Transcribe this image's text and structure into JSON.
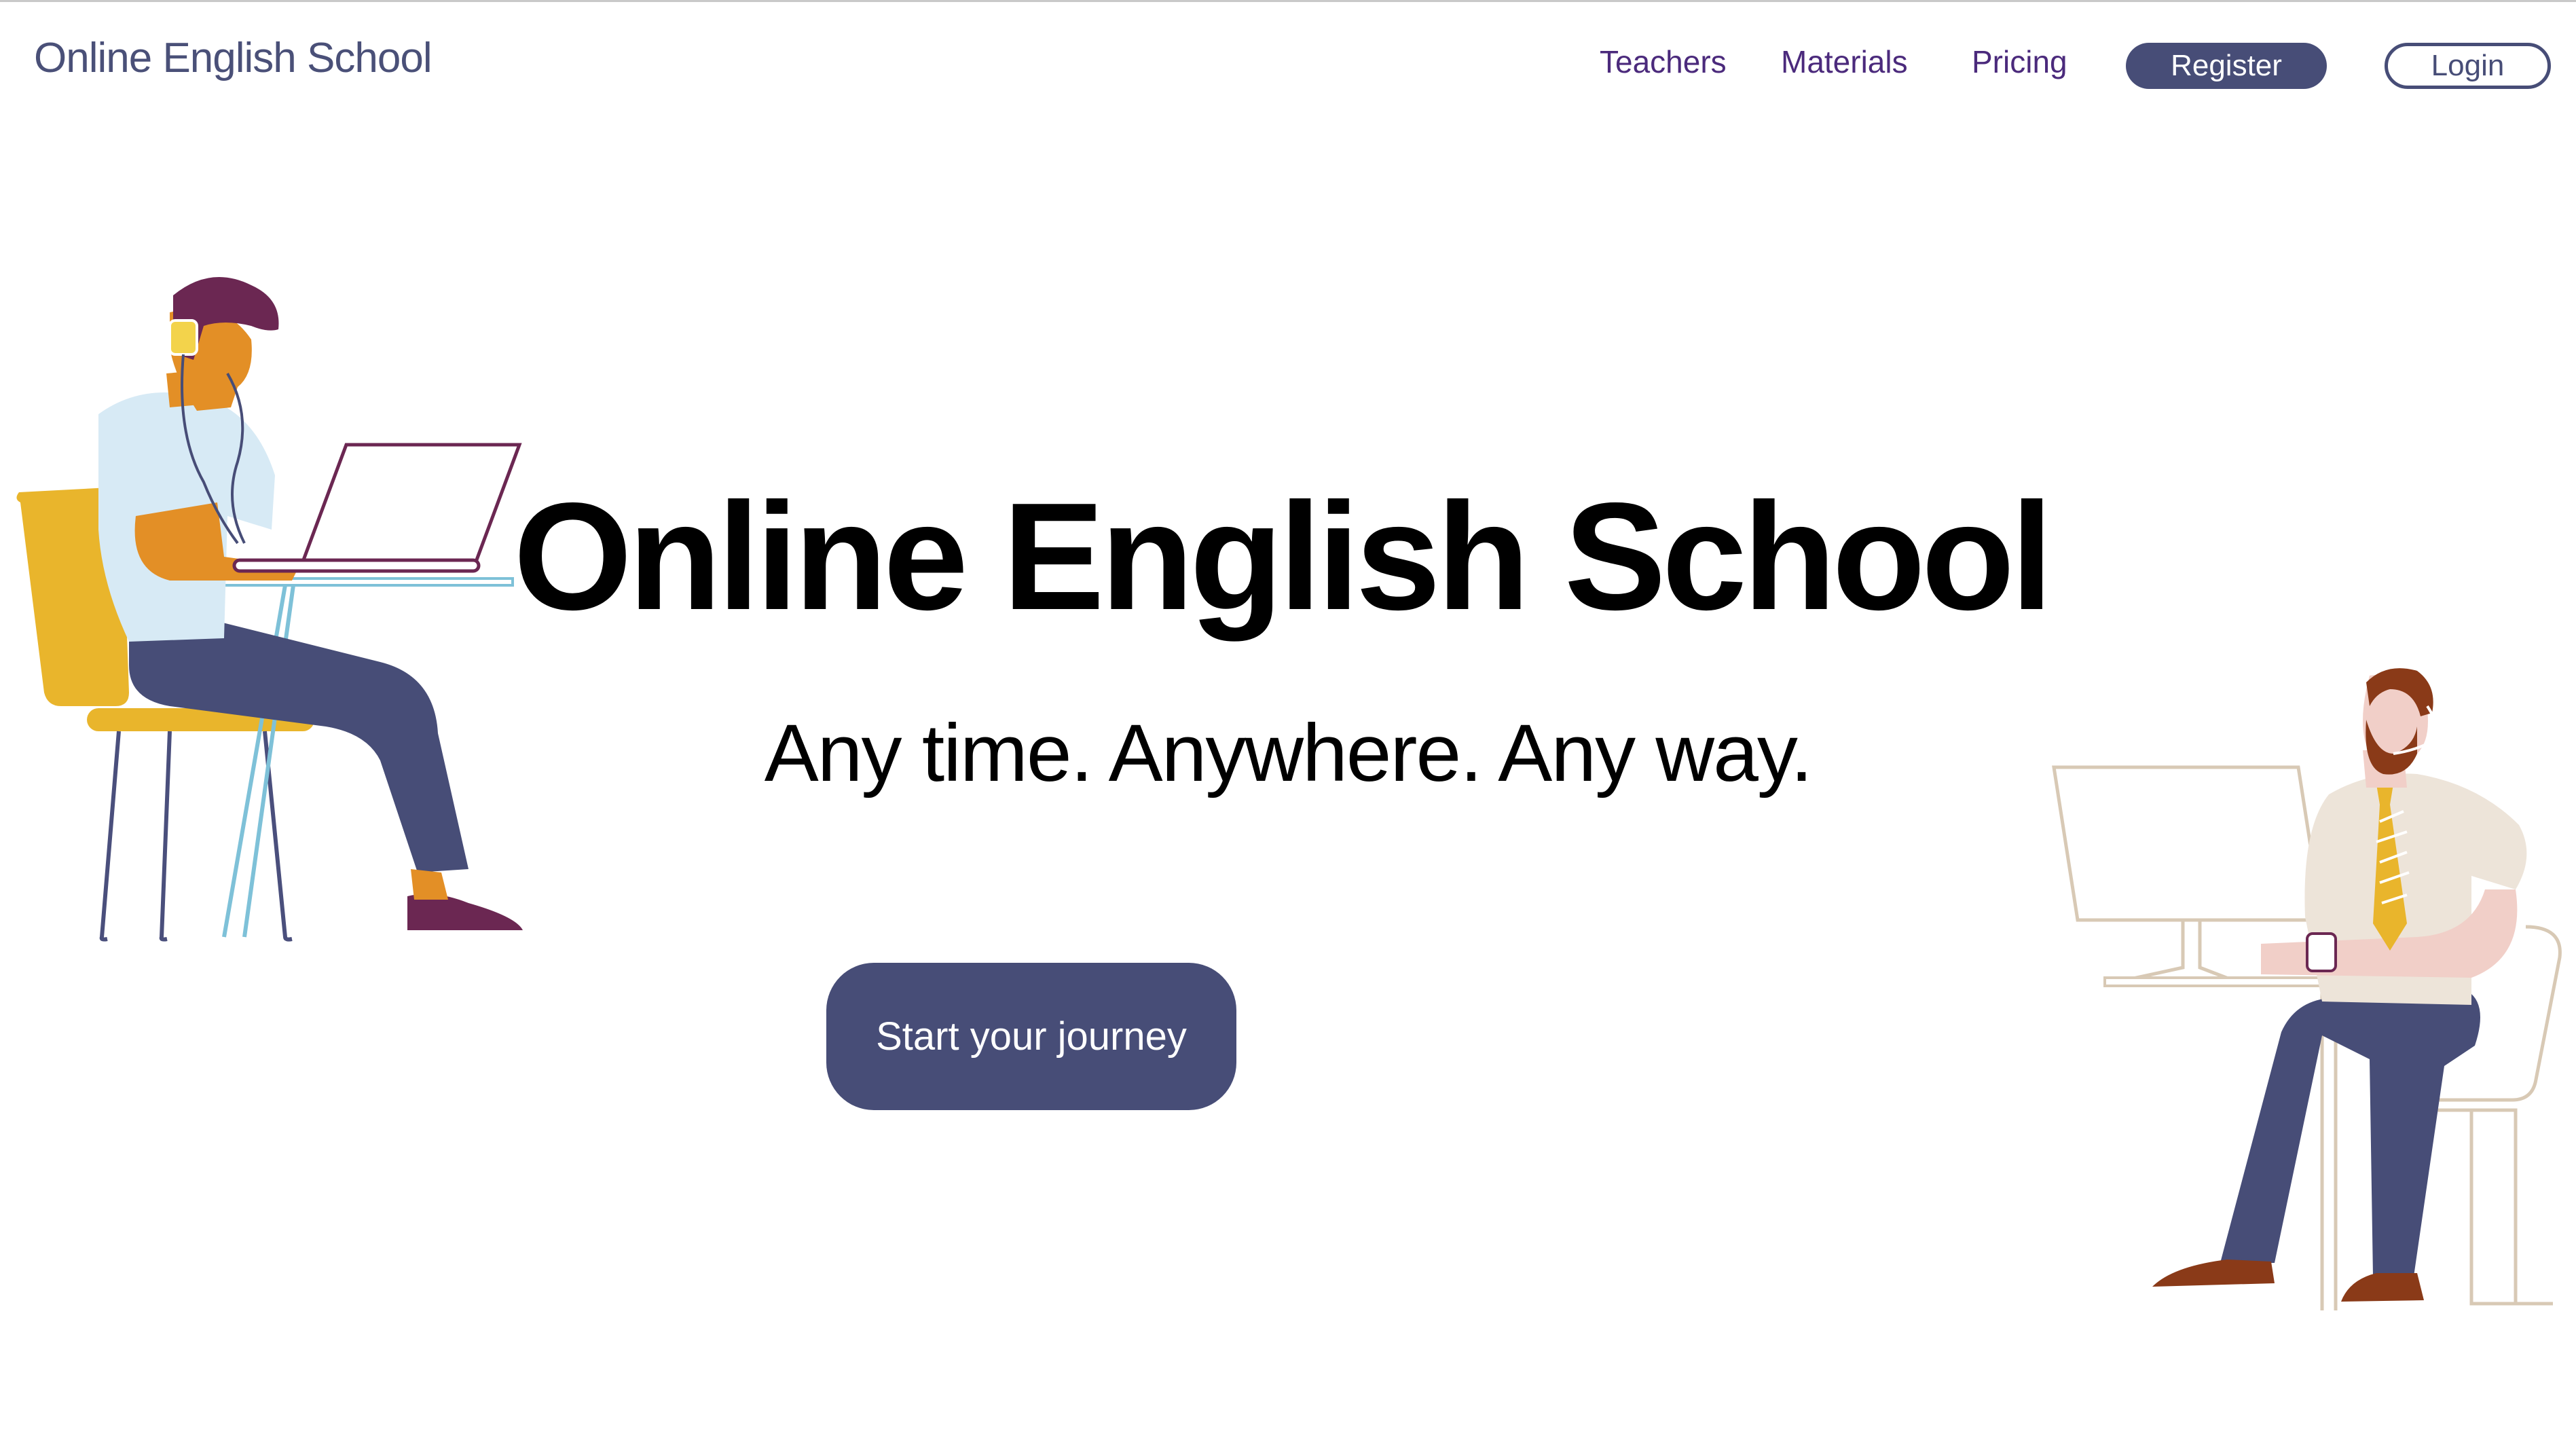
{
  "header": {
    "brand": "Online English School",
    "nav": {
      "teachers": "Teachers",
      "materials": "Materials",
      "pricing": "Pricing"
    },
    "register_label": "Register",
    "login_label": "Login"
  },
  "hero": {
    "title": "Online English School",
    "subtitle": "Any time. Anywhere. Any way.",
    "cta_label": "Start your journey"
  },
  "colors": {
    "brand": "#4a5078",
    "nav_text": "#4b2a7c",
    "button_primary": "#474d77",
    "background": "#ffffff"
  },
  "illustrations": {
    "left": "student-with-laptop-illustration",
    "right": "teacher-at-computer-illustration"
  }
}
